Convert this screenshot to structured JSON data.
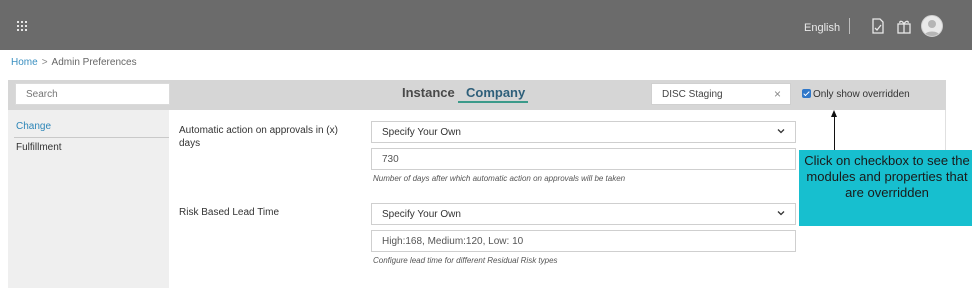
{
  "topbar": {
    "apps_icon": "grid-icon",
    "language": "English",
    "icons": [
      "document-icon",
      "gift-icon",
      "user-avatar-icon"
    ]
  },
  "breadcrumb": {
    "home": "Home",
    "separator": ">",
    "current": "Admin Preferences"
  },
  "toolbar": {
    "search_placeholder": "Search",
    "tabs": [
      {
        "label": "Instance",
        "active": false
      },
      {
        "label": "Company",
        "active": true
      }
    ],
    "environment": "DISC Staging",
    "clear_icon": "×",
    "only_overridden_label": "Only show overridden",
    "only_overridden_checked": true
  },
  "sidebar": {
    "items": [
      {
        "label": "Change",
        "active": true
      },
      {
        "label": "Fulfillment",
        "active": false
      }
    ]
  },
  "settings": [
    {
      "label": "Automatic action on approvals in (x) days",
      "select_value": "Specify Your Own",
      "input_value": "730",
      "help": "Number of days after which automatic action on approvals will be taken"
    },
    {
      "label": "Risk Based Lead Time",
      "select_value": "Specify Your Own",
      "input_value": "High:168, Medium:120, Low: 10",
      "help": "Configure lead time for different Residual Risk types"
    }
  ],
  "callout": {
    "text": "Click on checkbox to see the modules and properties that are overridden",
    "color": "#17bfcf"
  },
  "colors": {
    "topbar": "#6b6b6b",
    "toolbar": "#d6d6d6",
    "link": "#2d86b8",
    "checkbox": "#2f77c9",
    "tab_underline": "#3b9a8a"
  }
}
